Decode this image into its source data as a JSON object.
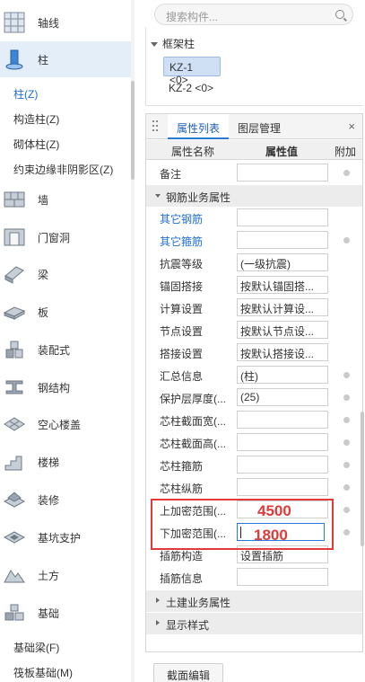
{
  "nav": {
    "axis": "轴线",
    "column": "柱",
    "column_subs": [
      "柱(Z)",
      "构造柱(Z)",
      "砌体柱(Z)",
      "约束边缘非阴影区(Z)"
    ],
    "wall": "墙",
    "door_window": "门窗洞",
    "beam": "梁",
    "slab": "板",
    "prefab": "装配式",
    "steel": "钢结构",
    "hollow_floor": "空心楼盖",
    "stair": "楼梯",
    "decoration": "装修",
    "pit_support": "基坑支护",
    "earthwork": "土方",
    "foundation": "基础",
    "foundation_subs": [
      "基础梁(F)",
      "筏板基础(M)"
    ]
  },
  "search": {
    "placeholder": "搜索构件..."
  },
  "tree": {
    "root": "框架柱",
    "nodes": [
      "KZ-1 <0>",
      "KZ-2 <0>"
    ]
  },
  "panel": {
    "tabs": [
      "属性列表",
      "图层管理"
    ],
    "close": "×",
    "headers": {
      "name": "属性名称",
      "value": "属性值",
      "extra": "附加"
    },
    "row_note": "备注",
    "group_rebar": "钢筋业务属性",
    "rows": [
      {
        "name": "其它钢筋",
        "value": ""
      },
      {
        "name": "其它箍筋",
        "value": ""
      },
      {
        "name": "抗震等级",
        "value": "(一级抗震)"
      },
      {
        "name": "锚固搭接",
        "value": "按默认锚固搭..."
      },
      {
        "name": "计算设置",
        "value": "按默认计算设..."
      },
      {
        "name": "节点设置",
        "value": "按默认节点设..."
      },
      {
        "name": "搭接设置",
        "value": "按默认搭接设..."
      },
      {
        "name": "汇总信息",
        "value": "(柱)"
      },
      {
        "name": "保护层厚度(...",
        "value": "(25)"
      },
      {
        "name": "芯柱截面宽(...",
        "value": ""
      },
      {
        "name": "芯柱截面高(...",
        "value": ""
      },
      {
        "name": "芯柱箍筋",
        "value": ""
      },
      {
        "name": "芯柱纵筋",
        "value": ""
      },
      {
        "name": "上加密范围(...",
        "value": ""
      },
      {
        "name": "下加密范围(...",
        "value": ""
      },
      {
        "name": "插筋构造",
        "value": "设置插筋"
      },
      {
        "name": "插筋信息",
        "value": ""
      }
    ],
    "group_civil": "土建业务属性",
    "group_display": "显示样式"
  },
  "annotations": {
    "upper": "4500",
    "lower": "1800"
  },
  "bottom_button": "截面编辑",
  "colors": {
    "accent": "#2b7bd6",
    "highlight": "#e03a3a",
    "link": "#1f6fd1"
  }
}
